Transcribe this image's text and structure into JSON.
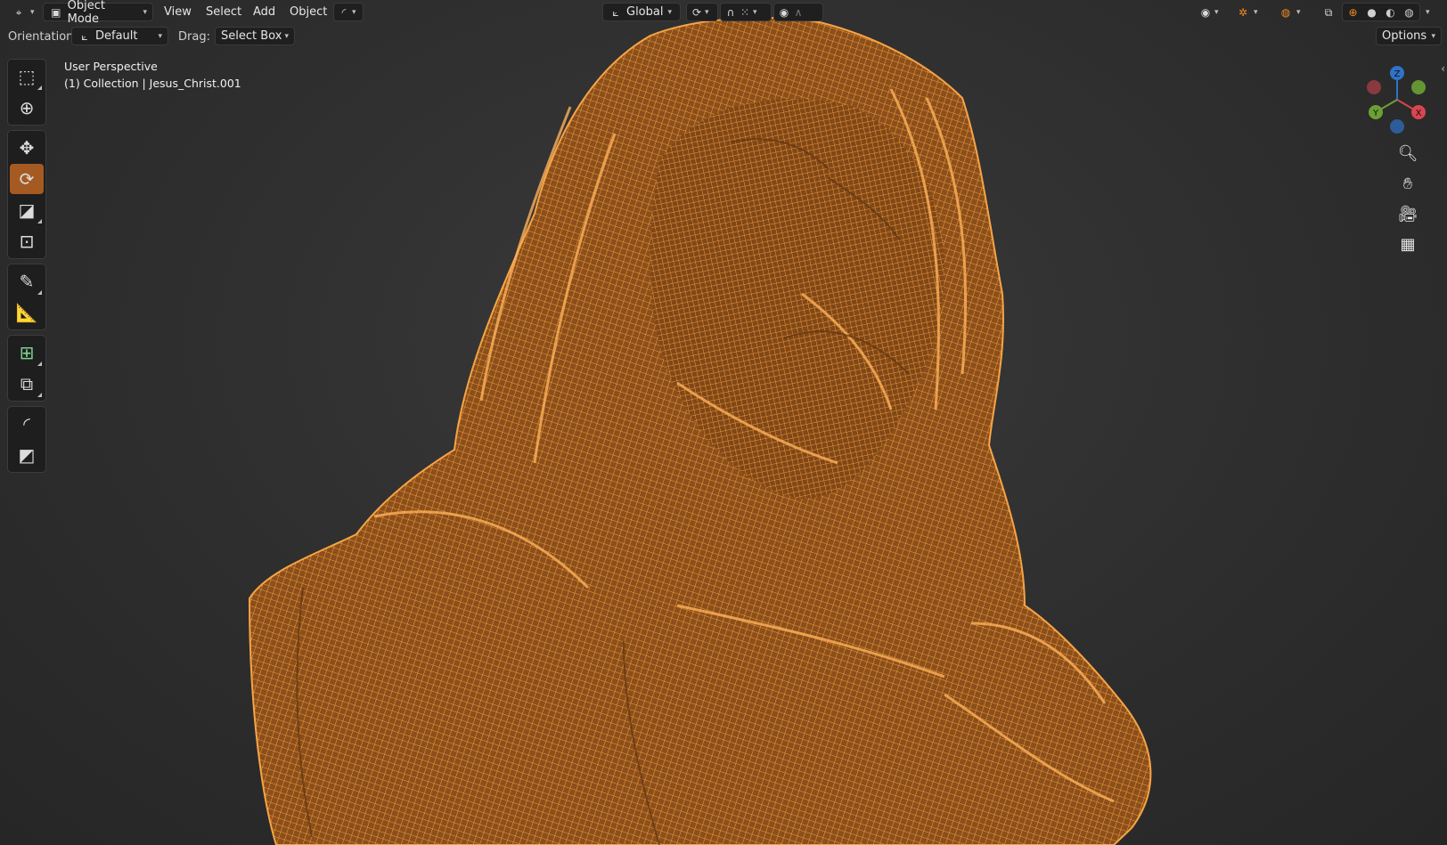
{
  "header": {
    "editor_type_icon": "view3d-icon",
    "mode": "Object Mode",
    "menus": [
      "View",
      "Select",
      "Add",
      "Object"
    ],
    "transform_orientation": "Global",
    "shading_modes": [
      "wireframe",
      "solid",
      "material",
      "rendered"
    ],
    "active_shading": "wireframe"
  },
  "tool_settings": {
    "orientation_label": "Orientation:",
    "orientation_value": "Default",
    "drag_label": "Drag:",
    "drag_value": "Select Box",
    "options_label": "Options"
  },
  "toolbar": {
    "tools": [
      {
        "name": "select-box",
        "icon": "select-box-icon",
        "active": false
      },
      {
        "name": "cursor",
        "icon": "cursor-icon",
        "active": false
      },
      {
        "name": "move",
        "icon": "move-icon",
        "active": false
      },
      {
        "name": "rotate",
        "icon": "rotate-icon",
        "active": true
      },
      {
        "name": "scale",
        "icon": "scale-icon",
        "active": false
      },
      {
        "name": "transform",
        "icon": "transform-icon",
        "active": false
      },
      {
        "name": "annotate",
        "icon": "annotate-icon",
        "active": false
      },
      {
        "name": "measure",
        "icon": "measure-icon",
        "active": false
      },
      {
        "name": "add-cube",
        "icon": "add-cube-icon",
        "active": false
      },
      {
        "name": "extrude",
        "icon": "extrude-icon",
        "active": false
      },
      {
        "name": "shear",
        "icon": "shear-icon",
        "active": false
      },
      {
        "name": "to-sphere",
        "icon": "to-sphere-icon",
        "active": false
      }
    ]
  },
  "viewport": {
    "perspective_label": "User Perspective",
    "collection_label": "(1) Collection | Jesus_Christ.001",
    "mesh_color": "#f08a24",
    "background_color": "#2e2e2e"
  },
  "gizmo": {
    "axes": [
      "Z",
      "Y",
      "X"
    ],
    "colors": {
      "x": "#d9464f",
      "y": "#6ba134",
      "z": "#2f73c9"
    }
  },
  "nav_buttons": [
    "zoom-icon",
    "hand-pan-icon",
    "camera-icon",
    "grid-icon"
  ]
}
